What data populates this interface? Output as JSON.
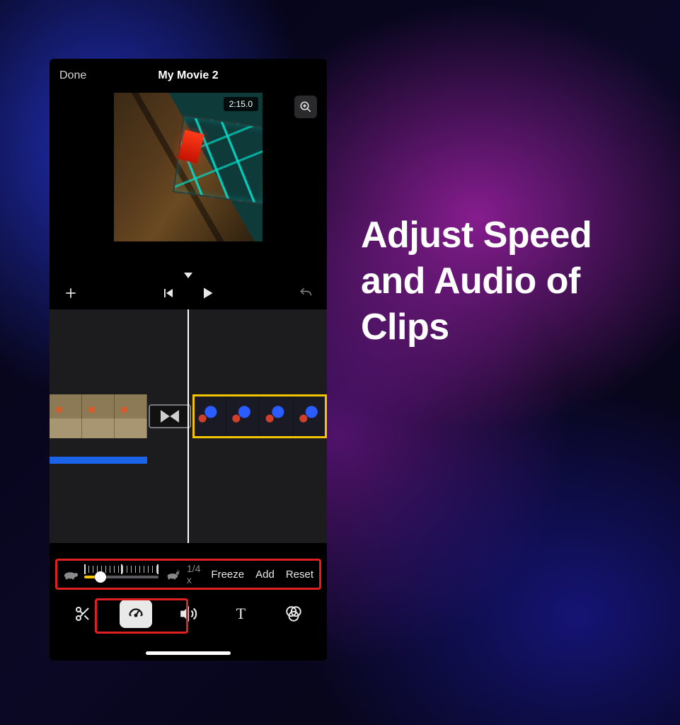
{
  "headline": "Adjust Speed and Audio of Clips",
  "header": {
    "done_label": "Done",
    "title": "My Movie 2"
  },
  "preview": {
    "timecode": "2:15.0"
  },
  "speed_panel": {
    "multiplier": "1/4 x",
    "freeze_label": "Freeze",
    "add_label": "Add",
    "reset_label": "Reset"
  },
  "toolbar": {
    "cut_icon": "scissors-icon",
    "speed_icon": "speedometer-icon",
    "volume_icon": "volume-icon",
    "text_icon_label": "T",
    "filters_icon": "filters-icon"
  }
}
